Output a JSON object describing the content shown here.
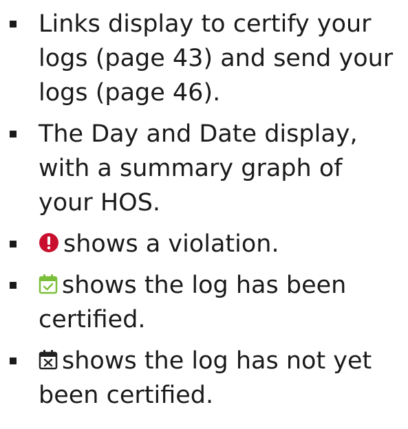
{
  "items": [
    {
      "text": "Links display to certify your logs (page 43) and send your logs (page 46)."
    },
    {
      "text": "The Day and Date display, with a summary graph of your HOS."
    },
    {
      "icon": "violation-icon",
      "text": "shows a violation."
    },
    {
      "icon": "certified-calendar-icon",
      "text": "shows the log has been certified."
    },
    {
      "icon": "not-certified-calendar-icon",
      "text": "shows the log has not yet been certified."
    }
  ],
  "colors": {
    "violation": "#c8102e",
    "certified": "#7cbf3a",
    "not_certified": "#222222",
    "text": "#1a1a1a"
  }
}
